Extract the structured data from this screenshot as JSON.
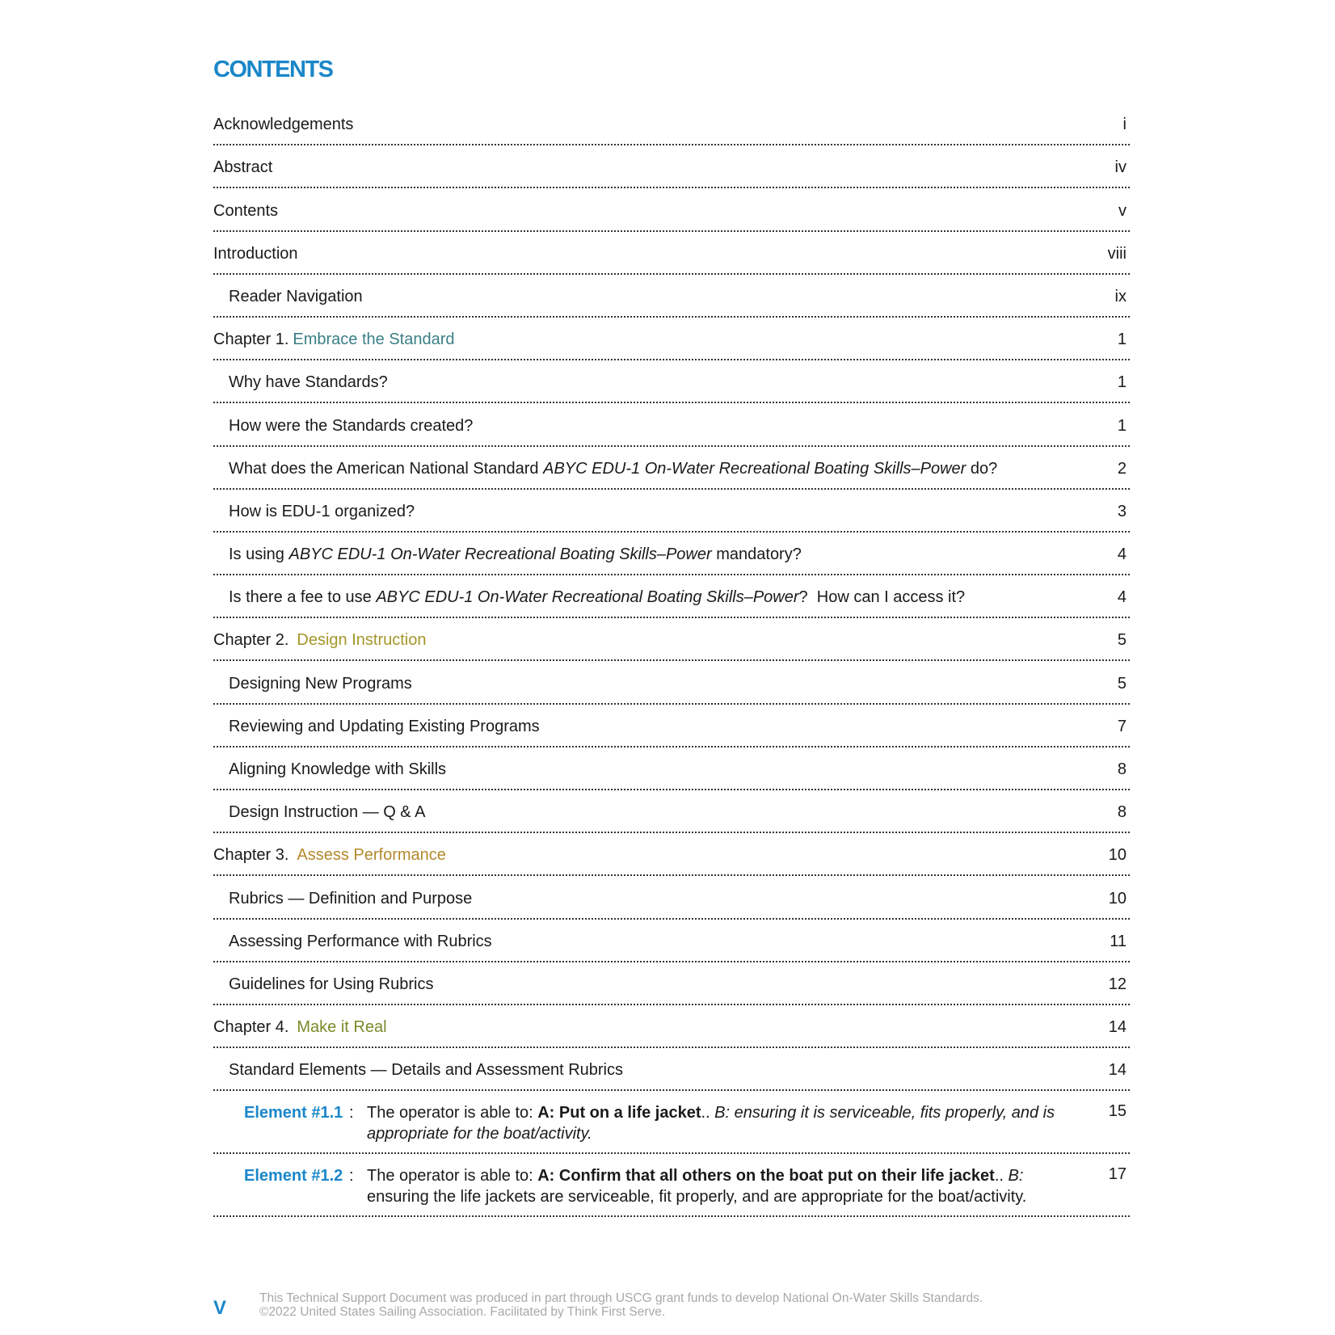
{
  "title": "CONTENTS",
  "colors": {
    "accent": "#1a87c9",
    "chapter1": "#3a7f86",
    "chapter2": "#a59628",
    "chapter3": "#b3892c",
    "chapter4": "#7a8a2a",
    "footer_text": "#a8a8a8"
  },
  "entries": [
    {
      "label": "Acknowledgements",
      "page": "i"
    },
    {
      "label": "Abstract",
      "page": "iv"
    },
    {
      "label": "Contents",
      "page": "v"
    },
    {
      "label": "Introduction",
      "page": "viii"
    },
    {
      "label": "Reader Navigation",
      "page": "ix"
    },
    {
      "chapter": "Chapter 1.",
      "title": "Embrace the Standard",
      "page": "1"
    },
    {
      "label": "Why have Standards?",
      "page": "1"
    },
    {
      "label": "How were the Standards created?",
      "page": "1"
    },
    {
      "pre": "What does the American National Standard ",
      "italic": "ABYC EDU-1 On-Water Recreational Boating Skills–Power",
      "post": " do?",
      "page": "2"
    },
    {
      "label": "How is EDU-1 organized?",
      "page": "3"
    },
    {
      "pre": "Is using ",
      "italic": "ABYC EDU-1 On-Water Recreational Boating Skills–Power",
      "post": " mandatory?",
      "page": "4"
    },
    {
      "pre": "Is there a fee to use ",
      "italic": "ABYC EDU-1 On-Water Recreational Boating Skills–Power",
      "post": "?  How can I access it?",
      "page": "4"
    },
    {
      "chapter": "Chapter 2.",
      "title": "Design Instruction",
      "page": "5"
    },
    {
      "label": "Designing New Programs",
      "page": "5"
    },
    {
      "label": "Reviewing and Updating Existing Programs",
      "page": "7"
    },
    {
      "label": "Aligning Knowledge with Skills",
      "page": "8"
    },
    {
      "label": "Design Instruction — Q & A",
      "page": "8"
    },
    {
      "chapter": "Chapter 3.",
      "title": "Assess Performance",
      "page": "10"
    },
    {
      "label": "Rubrics — Definition and Purpose",
      "page": "10"
    },
    {
      "label": "Assessing Performance with Rubrics",
      "page": "11"
    },
    {
      "label": "Guidelines for Using Rubrics",
      "page": "12"
    },
    {
      "chapter": "Chapter 4.",
      "title": "Make it Real",
      "page": "14"
    },
    {
      "label": "Standard Elements — Details and Assessment Rubrics",
      "page": "14"
    }
  ],
  "elements": [
    {
      "id": "Element #1.1",
      "colon": ":",
      "prefix": "The operator is able to: ",
      "bold": "A: Put on a life jacket",
      "dots": "..",
      "italic": " B: ensuring it is serviceable, fits properly, and is appropriate for the boat/activity.",
      "page": "15"
    },
    {
      "id": "Element #1.2",
      "colon": ":",
      "prefix": "The operator is able to: ",
      "bold": "A: Confirm that all others on the boat put on their life jacket",
      "dots": "..",
      "italic_b": " B:",
      "plain": " ensuring the life jackets are serviceable, fit properly, and are appropriate for the boat/activity.",
      "page": "17"
    }
  ],
  "footer": {
    "page_label": "V",
    "line1": "This Technical Support Document was produced in part through USCG grant funds to develop National On-Water Skills Standards.",
    "line2": "©2022 United States Sailing Association. Facilitated by Think First Serve."
  }
}
